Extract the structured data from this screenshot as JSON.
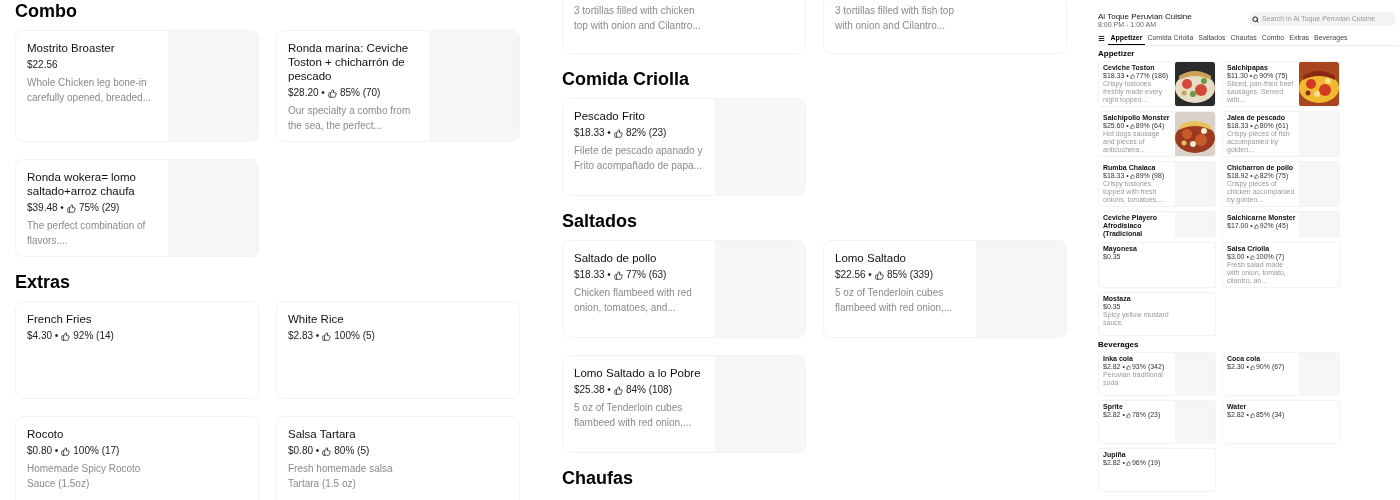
{
  "left_panel": {
    "sections": [
      {
        "title": "Combo",
        "items": [
          {
            "kind": "placeholder",
            "name": "Mostrito Broaster",
            "price": "$22.56",
            "description": "Whole Chicken leg bone-in carefully opened, breaded..."
          },
          {
            "kind": "placeholder",
            "name": "Ronda marina: Ceviche Toston + chicharrón de pescado",
            "price": "$28.20 •",
            "rating": "85% (70)",
            "description": "Our specialty a combo from the sea, the perfect..."
          },
          {
            "kind": "placeholder",
            "name": "Ronda wokera= lomo saltado+arroz chaufa",
            "price": "$39.48 •",
            "rating": "75% (29)",
            "description": "The perfect combination of flavors...."
          }
        ]
      },
      {
        "title": "Extras",
        "items": [
          {
            "kind": "plain",
            "name": "French Fries",
            "price": "$4.30 •",
            "rating": "92% (14)"
          },
          {
            "kind": "plain",
            "name": "White Rice",
            "price": "$2.83 •",
            "rating": "100% (5)"
          },
          {
            "kind": "plain",
            "name": "Rocoto",
            "price": "$0.80 •",
            "rating": "100% (17)",
            "description": "Homemade Spicy Rocoto Sauce (1.5oz)"
          },
          {
            "kind": "plain",
            "name": "Salsa Tartara",
            "price": "$0.80 •",
            "rating": "80% (5)",
            "description": "Fresh homemade salsa Tartara (1.5 oz)"
          }
        ]
      }
    ]
  },
  "middle_panel": {
    "sections": [
      {
        "items": [
          {
            "kind": "plain",
            "description": "3 tortillas filled with chicken top with onion and Cilantro..."
          },
          {
            "kind": "plain",
            "description": "3 tortillas filled with fish top with onion and Cilantro..."
          }
        ]
      },
      {
        "title": "Comida Criolla",
        "items": [
          {
            "kind": "placeholder",
            "name": "Pescado Frito",
            "price": "$18.33 •",
            "rating": "82% (23)",
            "description": "Filete de pescado apanado y Frito acompañado de papa..."
          }
        ]
      },
      {
        "title": "Saltados",
        "items": [
          {
            "kind": "placeholder",
            "name": "Saltado de pollo",
            "price": "$18.33 •",
            "rating": "77% (63)",
            "description": "Chicken flambeed with red onion, tomatoes, and..."
          },
          {
            "kind": "placeholder",
            "name": "Lomo Saltado",
            "price": "$22.56 •",
            "rating": "85% (339)",
            "description": "5 oz of Tenderloin cubes flambeed with red onion,..."
          },
          {
            "kind": "placeholder",
            "name": "Lomo Saltado a lo Pobre",
            "price": "$25.38 •",
            "rating": "84% (108)",
            "description": "5 oz of Tenderloin cubes flambeed with red onion,..."
          }
        ]
      },
      {
        "title": "Chaufas"
      }
    ]
  },
  "thumbnail": {
    "store": "Al Toque Peruvian Cuisine",
    "hours": "8:00 PM - 1:00 AM",
    "search": {
      "placeholder": "Search in Al Toque Peruvian Cuisine"
    },
    "tabs": [
      {
        "label": "Appetizer",
        "selected": true
      },
      {
        "label": "Comida Criolla",
        "selected": false
      },
      {
        "label": "Saltados",
        "selected": false
      },
      {
        "label": "Chaufas",
        "selected": false
      },
      {
        "label": "Combo",
        "selected": false
      },
      {
        "label": "Extras",
        "selected": false
      },
      {
        "label": "Beverages",
        "selected": false
      }
    ],
    "sections": [
      {
        "title": "Appetizer",
        "clipped": false,
        "items": [
          {
            "kind": "picture",
            "name": "Ceviche Toston",
            "price": "$18.33 •",
            "rating": "77% (186)",
            "description": "Crispy tostones freshly made every night topped..."
          },
          {
            "kind": "picture",
            "name": "Salchipapas",
            "price": "$11.30 •",
            "rating": "90% (75)",
            "description": "Sliced, pan-fried beef sausages. Served with..."
          },
          {
            "kind": "picture",
            "name": "Salchipollo Monster",
            "price": "$25.60 •",
            "rating": "89% (64)",
            "description": "Hot dogs sausage and pieces of anticuchera..."
          },
          {
            "kind": "placeholder",
            "name": "Jalea de pescado",
            "price": "$18.33 •",
            "rating": "80% (61)",
            "description": "Crispy pieces of fish accompanied by golden..."
          },
          {
            "kind": "placeholder",
            "name": "Rumba Chalaca",
            "price": "$18.33 •",
            "rating": "89% (98)",
            "description": "Crispy tostones topped with fresh onions, tomatoes,..."
          },
          {
            "kind": "placeholder",
            "name": "Chicharron de pollo",
            "price": "$18.92 •",
            "rating": "82% (75)",
            "description": "Crispy pieces of chicken accompanied by golden..."
          }
        ]
      },
      {
        "clipped": true,
        "items": [
          {
            "kind": "placeholder",
            "name": "Ceviche Playero Afrodisiaco (Tradicional"
          },
          {
            "kind": "placeholder",
            "name": "Salchicarne Monster",
            "price": "$17.00 •",
            "rating": "92% (45)"
          }
        ]
      },
      {
        "clipped": false,
        "items": [
          {
            "kind": "plain",
            "name": "Mayonesa",
            "price": "$0.35"
          },
          {
            "kind": "plain",
            "name": "Salsa Criolla",
            "price": "$3.00 •",
            "rating": "100% (7)",
            "description": "Fresh salad made with onion, tomato, cilantro, an..."
          },
          {
            "kind": "plain",
            "name": "Mostaza",
            "price": "$0.35",
            "description": "Spicy yellow mustard sauce."
          }
        ]
      },
      {
        "title": "Beverages",
        "clipped": false,
        "items": [
          {
            "kind": "placeholder",
            "name": "Inka cola",
            "price": "$2.82 •",
            "rating": "93% (342)",
            "description": "Peruvian traditional soda"
          },
          {
            "kind": "placeholder",
            "name": "Coca cola",
            "price": "$2.30 •",
            "rating": "90% (67)"
          },
          {
            "kind": "placeholder",
            "name": "Sprite",
            "price": "$2.82 •",
            "rating": "78% (23)"
          },
          {
            "kind": "plain",
            "name": "Water",
            "price": "$2.82 •",
            "rating": "85% (34)"
          },
          {
            "kind": "plain",
            "name": "Jupiña",
            "price": "$2.82 •",
            "rating": "96% (19)"
          }
        ]
      }
    ]
  }
}
